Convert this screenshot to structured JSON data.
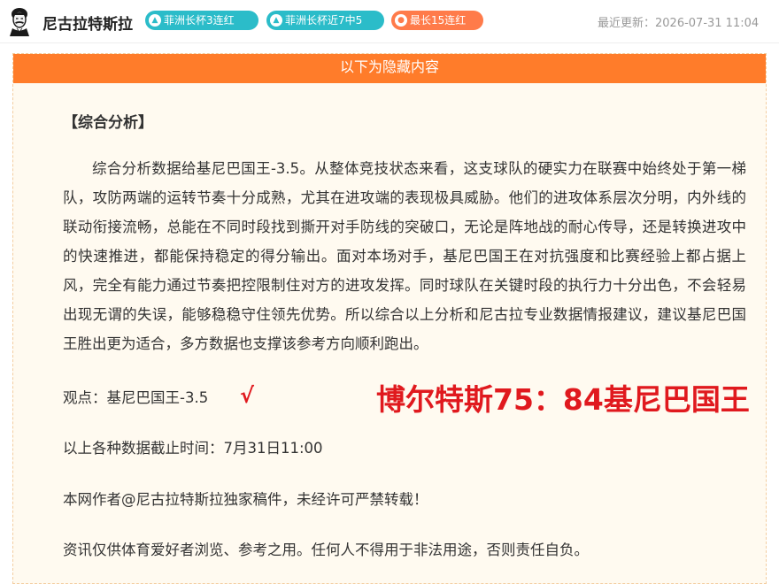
{
  "header": {
    "author": "尼古拉特斯拉",
    "badges": [
      {
        "label": "菲洲长杯3连红",
        "icon": "up-arrow-icon",
        "color": "#2bbcc9"
      },
      {
        "label": "菲洲长杯近7中5",
        "icon": "up-arrow-icon",
        "color": "#2bbcc9"
      },
      {
        "label": "最长15连红",
        "icon": "fire-icon",
        "color": "#ff7b4a"
      }
    ],
    "updated": "最近更新：2026-07-31 11:04"
  },
  "hidden_box": {
    "banner": "以下为隐藏内容",
    "section_title": "【综合分析】",
    "paragraph": "综合分析数据给基尼巴国王-3.5。从整体竞技状态来看，这支球队的硬实力在联赛中始终处于第一梯队，攻防两端的运转节奏十分成熟，尤其在进攻端的表现极具威胁。他们的进攻体系层次分明，内外线的联动衔接流畅，总能在不同时段找到撕开对手防线的突破口，无论是阵地战的耐心传导，还是转换进攻中的快速推进，都能保持稳定的得分输出。面对本场对手，基尼巴国王在对抗强度和比赛经验上都占据上风，完全有能力通过节奏把控限制住对方的进攻发挥。同时球队在关键时段的执行力十分出色，不会轻易出现无谓的失误，能够稳稳守住领先优势。所以综合以上分析和尼古拉专业数据情报建议，建议基尼巴国王胜出更为适合，多方数据也支撑该参考方向顺利跑出。",
    "viewpoint": "观点：基尼巴国王-3.5",
    "check_mark": "√",
    "result": "博尔特斯75：84基尼巴国王",
    "cutoff": "以上各种数据截止时间：7月31日11:00",
    "copyright": "本网作者@尼古拉特斯拉独家稿件，未经许可严禁转载！",
    "disclaimer": "资讯仅供体育爱好者浏览、参考之用。任何人不得用于非法用途，否则责任自负。"
  },
  "colors": {
    "accent_orange": "#ff7c2a",
    "badge_teal": "#2bbcc9",
    "badge_orange": "#ff7b4a",
    "result_red": "#e0191e",
    "box_background": "#fffaf0"
  }
}
